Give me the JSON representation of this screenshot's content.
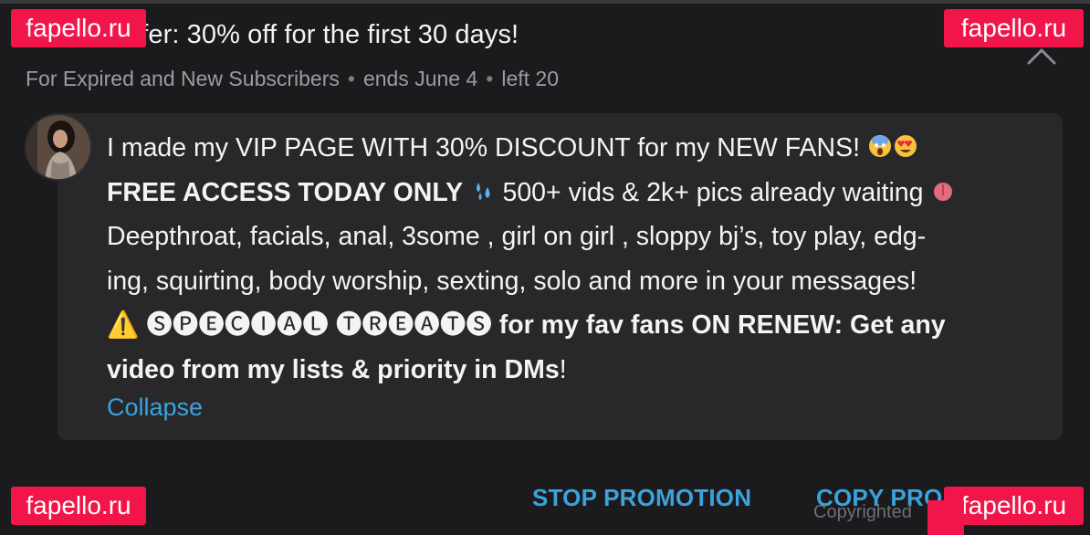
{
  "promo": {
    "headline": "Limited offer: 30% off for the first 30 days!",
    "audience": "For Expired and New Subscribers",
    "ends": "ends June 4",
    "left": "left 20"
  },
  "message": {
    "line1_text": "I made my VIP PAGE WITH 30% DISCOUNT for my NEW FANS! ",
    "line2_bold": "FREE ACCESS TODAY ONLY ",
    "line2_text": " 500+ vids & 2k+ pics already waiting ",
    "line3_text": "Deepthroat, facials, anal, 3some , girl on girl , sloppy bj’s, toy play, edg-",
    "line4_text": "ing, squirting, body worship, sexting, solo and more in your messages!",
    "line5_special": "⚠️ 🅢🅟🅔🅒🅘🅐🅛 🅣🅡🅔🅐🅣🅢",
    "line5_bold": " for my fav fans ON RENEW: Get any",
    "line6_bold": "video from my lists & priority in DMs",
    "line6_end": "!",
    "collapse_label": "Collapse"
  },
  "actions": {
    "stop_promotion": "STOP PROMOTION",
    "copy_promotion": "COPY PROMOTION"
  },
  "footer": {
    "copyright": "Copyrighted"
  },
  "watermarks": {
    "text": "fapello.ru"
  },
  "colors": {
    "background": "#1b1b1d",
    "card": "#28282b",
    "link": "#3aa3dd",
    "watermark": "#f2154a"
  }
}
